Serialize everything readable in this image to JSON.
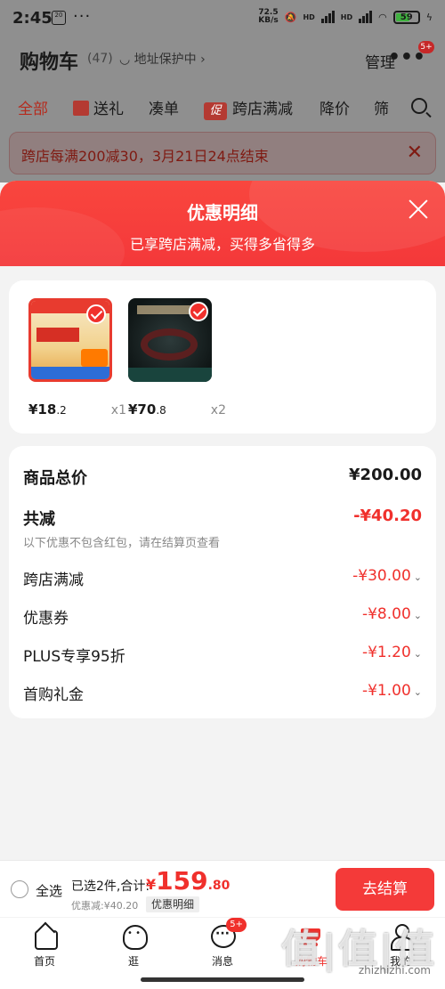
{
  "status_bar": {
    "time": "2:45",
    "chip": "20",
    "dots": "···",
    "speed_value": "72.5",
    "speed_unit": "KB/s",
    "signal_label_1": "HD",
    "signal_label_2": "HD",
    "battery": "59"
  },
  "cart_header": {
    "title": "购物车",
    "count": "(47)",
    "address": "◡ 地址保护中 ›",
    "manage": "管理",
    "more": "•••",
    "more_badge": "5+"
  },
  "filters": {
    "all": "全部",
    "gift": "送礼",
    "combine": "凑单",
    "cu_icon": "促",
    "cross_store": "跨店满减",
    "price_drop": "降价",
    "filter": "筛"
  },
  "promo_banner": {
    "text": "跨店每满200减30，3月21日24点结束",
    "close": "✕"
  },
  "sheet": {
    "title": "优惠明细",
    "subtitle": "已享跨店满减，买得多省得多"
  },
  "products": [
    {
      "price_int": "¥18",
      "price_dec": ".2",
      "qty": "x1",
      "icon": "medicine-box-icon"
    },
    {
      "price_int": "¥70",
      "price_dec": ".8",
      "qty": "x2",
      "icon": "bead-bracelet-icon"
    }
  ],
  "summary": {
    "total_label": "商品总价",
    "total_value": "¥200.00",
    "reduced_label": "共减",
    "reduced_value": "-¥40.20",
    "note": "以下优惠不包含红包，请在结算页查看",
    "items": [
      {
        "label": "跨店满减",
        "value": "-¥30.00"
      },
      {
        "label": "优惠券",
        "value": "-¥8.00"
      },
      {
        "label": "PLUS专享95折",
        "value": "-¥1.20"
      },
      {
        "label": "首购礼金",
        "value": "-¥1.00"
      }
    ],
    "chevron": "⌄"
  },
  "checkout": {
    "select_all": "全选",
    "selected_info": "已选2件,合计:",
    "currency": "¥",
    "total_int": "159",
    "total_dec": ".80",
    "discount": "优惠减:¥40.20",
    "detail": "优惠明细",
    "button": "去结算"
  },
  "tabbar": {
    "home": "首页",
    "browse": "逛",
    "messages": "消息",
    "messages_badge": "5+",
    "cart": "购物车",
    "me": "我的"
  },
  "watermark": {
    "logo": "值|值|值",
    "site": "zhizhizhi.com"
  },
  "colors": {
    "accent_red": "#f0302c",
    "header_red": "#f9463e",
    "dim_overlay": "#8f8f8f"
  }
}
